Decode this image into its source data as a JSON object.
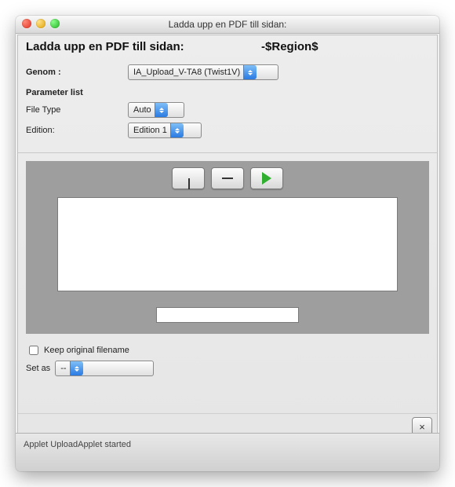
{
  "window": {
    "title": "Ladda upp en PDF till sidan:"
  },
  "header": {
    "text": "Ladda upp en PDF till sidan:",
    "region_placeholder": "-$Region$"
  },
  "form": {
    "genom_label": "Genom :",
    "genom_value": "IA_Upload_V-TA8 (Twist1V)",
    "param_heading": "Parameter list",
    "file_type_label": "File Type",
    "file_type_value": "Auto",
    "edition_label": "Edition:",
    "edition_value": "Edition 1"
  },
  "lower": {
    "keep_filename_label": "Keep original filename",
    "set_as_label": "Set as",
    "set_as_value": "--"
  },
  "footer": {
    "close_label": "×"
  },
  "status": {
    "text": "Applet UploadApplet started"
  }
}
